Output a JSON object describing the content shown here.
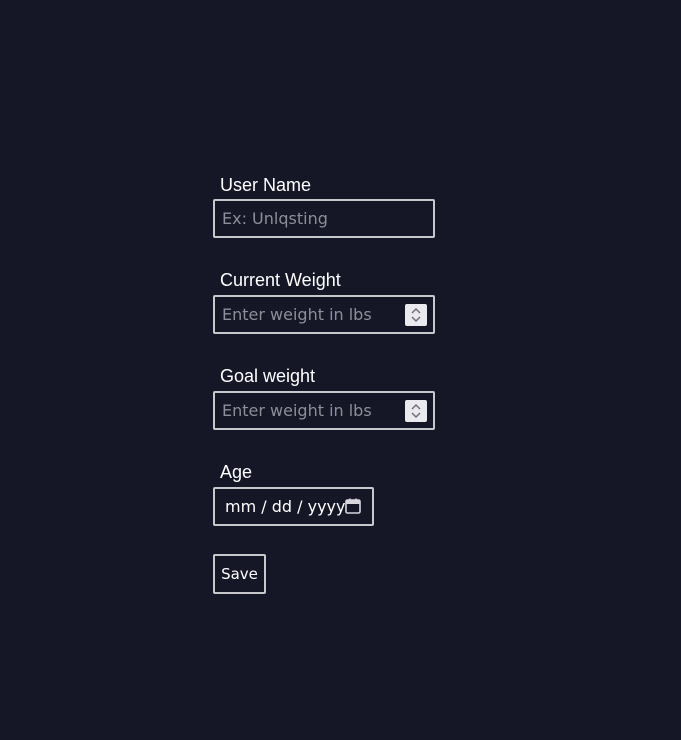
{
  "form": {
    "username": {
      "label": "User Name",
      "placeholder": "Ex: Unlqsting",
      "value": ""
    },
    "current_weight": {
      "label": "Current Weight",
      "placeholder": "Enter weight in lbs",
      "value": ""
    },
    "goal_weight": {
      "label": "Goal weight",
      "placeholder": "Enter weight in lbs",
      "value": ""
    },
    "age": {
      "label": "Age",
      "date_format": "mm / dd / yyyy"
    },
    "save_label": "Save"
  },
  "icons": {
    "spinner": "number-spinner-icon",
    "calendar": "calendar-icon"
  },
  "colors": {
    "background": "#151727",
    "border": "#c8c8cc",
    "placeholder": "#8d8e98",
    "text": "#ffffff"
  }
}
